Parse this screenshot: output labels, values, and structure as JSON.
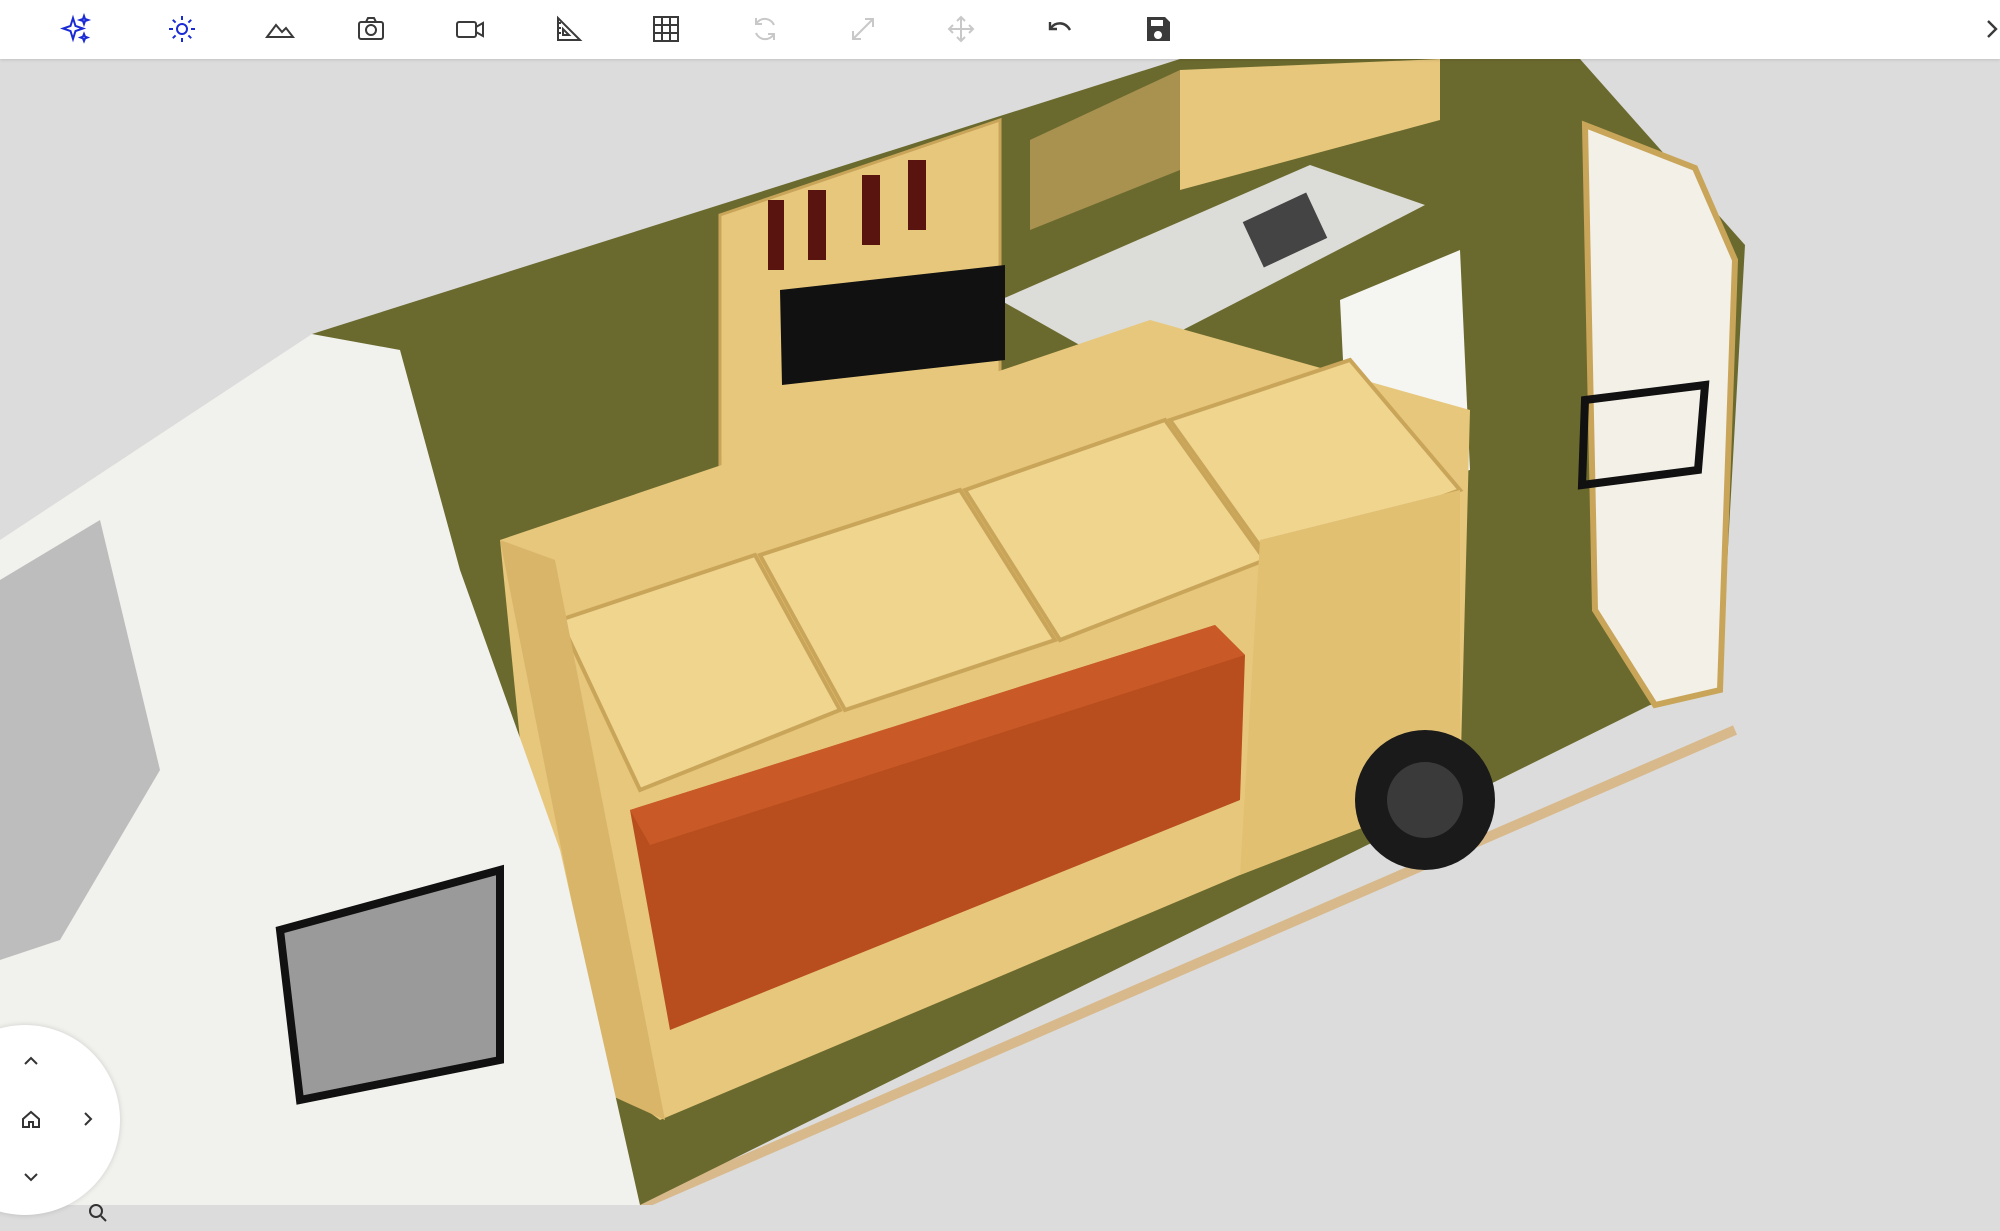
{
  "toolbar": {
    "tools": [
      {
        "id": "ai",
        "icon": "sparkles-icon",
        "active": true
      },
      {
        "id": "light",
        "icon": "sun-icon",
        "active": true
      },
      {
        "id": "environment",
        "icon": "mountains-icon",
        "active": false
      },
      {
        "id": "screenshot",
        "icon": "camera-icon",
        "active": false
      },
      {
        "id": "video",
        "icon": "video-camera-icon",
        "active": false
      },
      {
        "id": "measure",
        "icon": "set-square-icon",
        "active": false
      },
      {
        "id": "grid",
        "icon": "grid-icon",
        "active": false
      },
      {
        "id": "rotate",
        "icon": "rotate-icon",
        "disabled": true
      },
      {
        "id": "scale",
        "icon": "resize-icon",
        "disabled": true
      },
      {
        "id": "move",
        "icon": "move-icon",
        "disabled": true
      },
      {
        "id": "undo",
        "icon": "undo-icon",
        "active": false
      },
      {
        "id": "save",
        "icon": "floppy-disk-icon",
        "active": false
      },
      {
        "id": "collapse",
        "icon": "chevron-right-icon",
        "active": false
      }
    ],
    "colors": {
      "active": "#1a2bd6",
      "normal": "#3a3a3a",
      "disabled": "#c8c8c8"
    }
  },
  "navigator": {
    "buttons": [
      "chevron-up-icon",
      "home-icon",
      "chevron-right-icon",
      "chevron-down-icon",
      "zoom-icon"
    ]
  },
  "scene": {
    "colors": {
      "wood": "#e7c77c",
      "wood_dark": "#c9a55a",
      "cushion": "#b84d1d",
      "wall": "#6b6a2e",
      "van": "#f1f1ed",
      "counter": "#dcdcd8"
    }
  }
}
